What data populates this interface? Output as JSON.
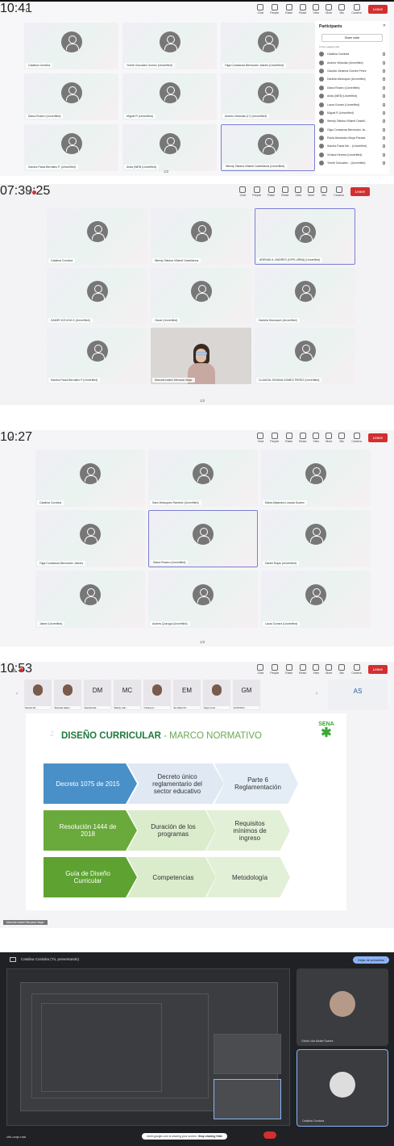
{
  "panel1": {
    "time": "10:41",
    "participants_title": "Participants",
    "share_invite": "Share invite",
    "in_meeting": "In the meeting (14)",
    "participants": [
      "Catalina Cordoba",
      "Andres Velandia (Unverified)",
      "Claudia Johanna Gomez Perez",
      "Daniela Marroquin (Unverified)",
      "Diana Rosero (Unverified)",
      "Anita (WEB (Unverified)",
      "Laura Gomez (Unverified)",
      "Miguel R (Unverified)",
      "Wendy Tatiana Villamil Castell...",
      "Olga Constanza Bermudez Ja...",
      "Paola Alexandra Moya Parada",
      "Sandra Paola Me... (Unverified)",
      "Viviana Herrera (Unverified)",
      "Yineth Gonzalez... (Unverified)"
    ],
    "tiles": [
      "Catalina Cordoba",
      "Yineth Gonzalez Gomez (Unverified)",
      "Olga Constanza Bermudez Jaimes (Unverified)",
      "Diana Rosero (Unverified)",
      "Miguel R (Unverified)",
      "Andres Velandia (17) (Unverified)",
      "Sandra Paola Bernales P. (Unverified)",
      "Anita (WEB (Unverified)",
      "Wendy Tatiana Villamil Castellanos (Unverified)"
    ],
    "pager": "1/2"
  },
  "panel2": {
    "time": "07:39:25",
    "tiles": [
      "Catalina Cordoba",
      "Wendy Tatiana Villamil Castellanos",
      "ARENAS A. ANDRES (GFPI-URBA) (Unverified)",
      "SAMIR VIZCAYA S (Unverified)",
      "Oscar (Unverified)",
      "Daniela Marroquin (Unverified)",
      "Sandra Paola Bernales P (Unverified)",
      "Marcela Isabel Mercado Bejar",
      "CLAUDIA JOHANA GOMEZ PEREZ (Unverified)"
    ],
    "pager": "1/2"
  },
  "panel3": {
    "time": "10:27",
    "tiles": [
      "Catalina Cordoba",
      "Sara Velasquez Ramirez (Unverified)",
      "Maria Alejandra Losada Suarez",
      "Olga Constanza Bermudez Jaimes",
      "Diana Rosero (Unverified)",
      "Daniel Rojas (Unverified)",
      "Jaime (Unverified)",
      "Andres Quiroga (Unverified)",
      "Laura Gomez (Unverified)"
    ],
    "pager": "1/2"
  },
  "panel4": {
    "time": "10:53",
    "thumbs": [
      {
        "ini": "",
        "name": "Sandra Pa..."
      },
      {
        "ini": "",
        "name": "Marcela Isabel..."
      },
      {
        "ini": "DM",
        "name": "Daniela Ma..."
      },
      {
        "ini": "MC",
        "name": "Miledy Cab..."
      },
      {
        "ini": "",
        "name": "Viviana H..."
      },
      {
        "ini": "EM",
        "name": "Ex Milani M..."
      },
      {
        "ini": "",
        "name": "Olga Const..."
      },
      {
        "ini": "GM",
        "name": "GUSTAVO..."
      }
    ],
    "side_initials": "AS",
    "slide_number": "2",
    "slide_title": "DISEÑO CURRICULAR",
    "slide_subtitle": "- MARCO NORMATIVO",
    "logo_text": "SENA",
    "chevrons": [
      "Decreto 1075 de 2015",
      "Decreto único reglamentario del sector educativo",
      "Parte 6 Reglamentación",
      "Resolución 1444 de 2018",
      "Duración de los programas",
      "Requisitos mínimos de ingreso",
      "Guía de Diseño Curricular",
      "Competencias",
      "Metodología"
    ],
    "presenter": "Marcela Isabel Mercado Bejar"
  },
  "panel5": {
    "title": "Catalina Cordoba (Tú, presentando)",
    "stop_button": "Dejar de presentar",
    "tile_top": "Gloria Lida Alzate Suarez",
    "tile_bottom": "Catalina Cordoba",
    "meeting_code": "chk-uzqx-naa",
    "sharing_text": "meet.google.com is sharing your screen.",
    "stop_sharing": "Stop sharing",
    "hide": "Hide"
  },
  "colors": {
    "leave": "#d32f2f",
    "selected_border": "#7b7fd1",
    "chev_blue": "#4a90c8",
    "chev_green": "#6aaa3c",
    "title_green": "#1f7a3c"
  },
  "toolbar": {
    "chat": "Chat",
    "people": "People",
    "raise": "Raise",
    "react": "React",
    "view": "View",
    "more": "More",
    "mic": "Mic",
    "camera": "Camera",
    "leave": "Leave"
  }
}
